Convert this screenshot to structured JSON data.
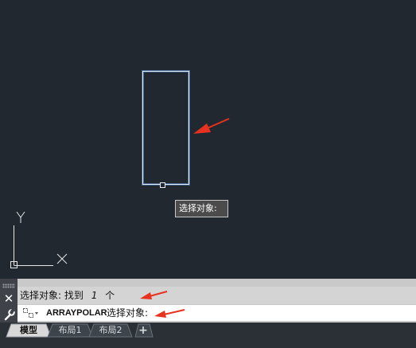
{
  "canvas": {
    "tooltip_text": "选择对象:",
    "ucs_y_label": "Y",
    "ucs_x_label": "X"
  },
  "command_line": {
    "close_glyph": "✕",
    "history_text": "选择对象: 找到",
    "history_count": "1",
    "history_unit": "个",
    "command_name": "ARRAYPOLAR",
    "prompt_text": "选择对象:"
  },
  "tabs": [
    {
      "label": "模型",
      "active": true
    },
    {
      "label": "布局1",
      "active": false
    },
    {
      "label": "布局2",
      "active": false
    }
  ],
  "add_tab_glyph": "+",
  "colors": {
    "canvas_bg": "#212830",
    "selected_object": "#e6eef8",
    "annotation_arrow": "#e8321f"
  }
}
